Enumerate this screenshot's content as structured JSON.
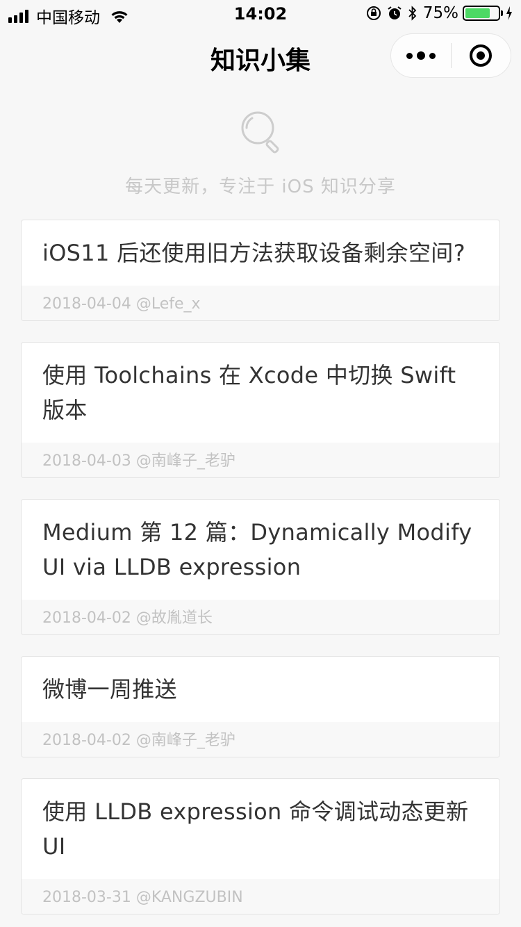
{
  "status_bar": {
    "carrier": "中国移动",
    "time": "14:02",
    "battery_percent": "75%",
    "battery_level": 0.75,
    "battery_color": "#4cd964"
  },
  "nav": {
    "title": "知识小集",
    "more_icon": "more-dots-icon",
    "close_icon": "close-miniprogram-icon"
  },
  "hero": {
    "icon": "search-icon",
    "tagline": "每天更新，专注于 iOS 知识分享"
  },
  "articles": [
    {
      "title": "iOS11 后还使用旧方法获取设备剩余空间?",
      "meta": "2018-04-04 @Lefe_x"
    },
    {
      "title": "使用 Toolchains 在 Xcode 中切换 Swift 版本",
      "meta": "2018-04-03 @南峰子_老驴"
    },
    {
      "title": "Medium 第 12 篇：Dynamically Modify UI via LLDB expression",
      "meta": "2018-04-02 @故胤道长"
    },
    {
      "title": "微博一周推送",
      "meta": "2018-04-02 @南峰子_老驴"
    },
    {
      "title": "使用 LLDB expression 命令调试动态更新 UI",
      "meta": "2018-03-31 @KANGZUBIN"
    }
  ]
}
